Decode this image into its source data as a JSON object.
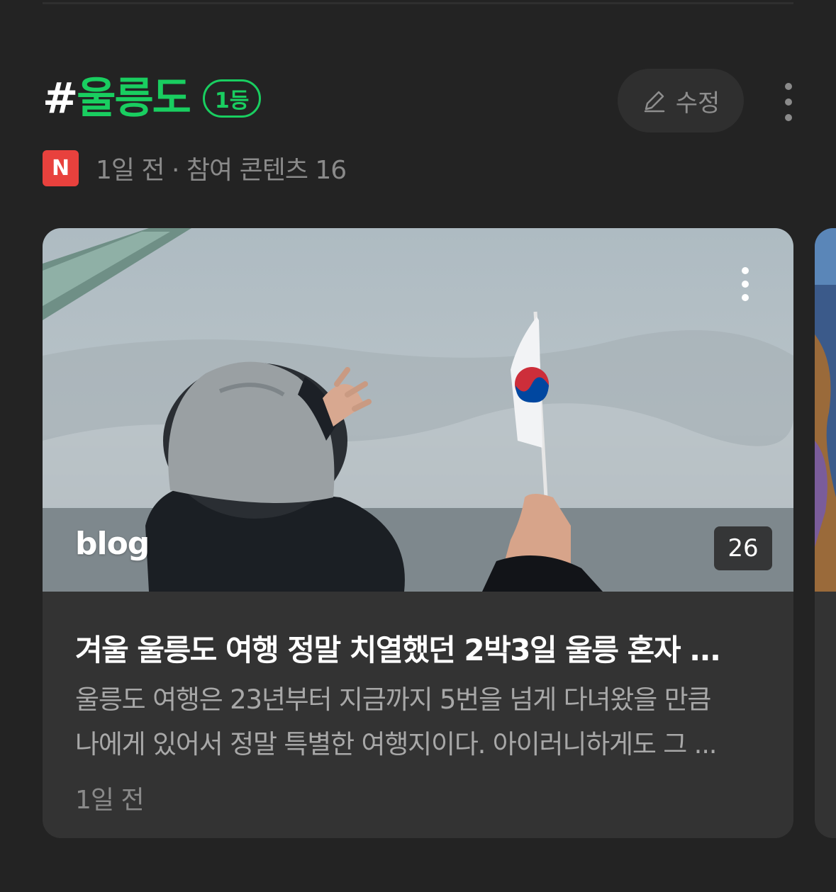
{
  "topic": {
    "hash": "#",
    "keyword": "울릉도",
    "rank_badge": "1등",
    "edit_label": "수정",
    "source_logo": "N",
    "meta": "1일 전 · 참여 콘텐츠 16"
  },
  "card": {
    "image_icon": "photo-person-with-korean-flag",
    "blog_mark": "blog",
    "count": "26",
    "title": "겨울 울릉도 여행 정말 치열했던 2박3일 울릉 혼자 ...",
    "desc_line1": "울릉도 여행은 23년부터 지금까지 5번을 넘게 다녀왔을 만큼",
    "desc_line2": "나에게 있어서 정말 특별한 여행지이다. 아이러니하게도 그 ...",
    "date": "1일 전"
  },
  "colors": {
    "background": "#232323",
    "accent_green": "#19ce60",
    "naver_red": "#e8413d",
    "card_bg": "#333333"
  }
}
